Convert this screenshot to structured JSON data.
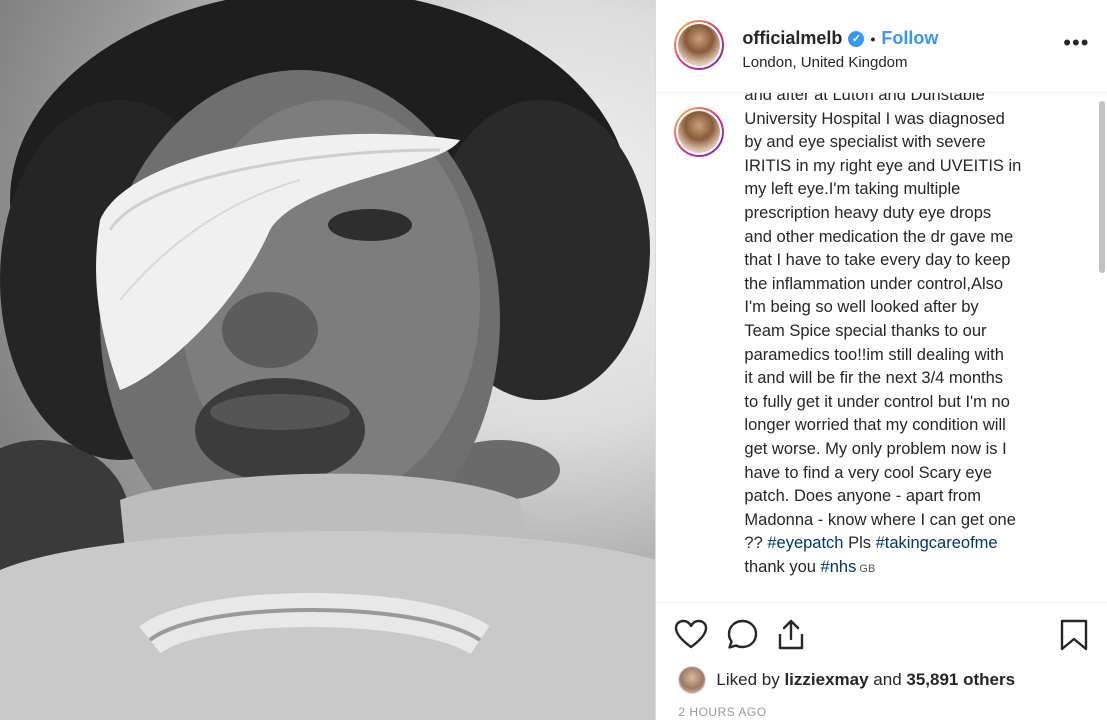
{
  "post": {
    "username": "officialmelb",
    "follow_label": "Follow",
    "separator": "•",
    "location": "London, United Kingdom",
    "more_label": "•••",
    "verified_mark": "✓"
  },
  "caption": {
    "text": "and after at Luton and Dunstable\nUniversity Hospital I was diagnosed\nby and eye specialist with severe\nIRITIS in my right eye and UVEITIS in\nmy left eye.I'm taking multiple\nprescription heavy duty eye drops\nand other medication the dr gave me\nthat I have to take every day to keep\nthe inflammation under control,Also\nI'm being so well looked after by\nTeam Spice special thanks to our\nparamedics too!!im still dealing with\nit and will be fir the next 3/4 months\nto fully get it under control but I'm no\nlonger worried that my condition will\nget worse. My only problem now is I\nhave to find a very cool Scary eye\npatch. Does anyone - apart from\nMadonna - know where I can get one\n?? ",
    "hashtag_1": "#eyepatch",
    "mid_text": " Pls ",
    "hashtag_2": "#takingcareofme",
    "thanks_text": "\nthank you ",
    "hashtag_3": "#nhs",
    "translation_tag": " GB"
  },
  "engagement": {
    "liked_prefix": "Liked by ",
    "liked_user": "lizziexmay",
    "liked_mid": " and ",
    "liked_count": "35,891 others",
    "time": "2 HOURS AGO"
  },
  "icons": {
    "like": "heart-icon",
    "comment": "comment-icon",
    "share": "share-icon",
    "save": "bookmark-icon"
  },
  "colors": {
    "link": "#3897f0",
    "hashtag": "#003569",
    "text": "#262626",
    "muted": "#999999"
  }
}
